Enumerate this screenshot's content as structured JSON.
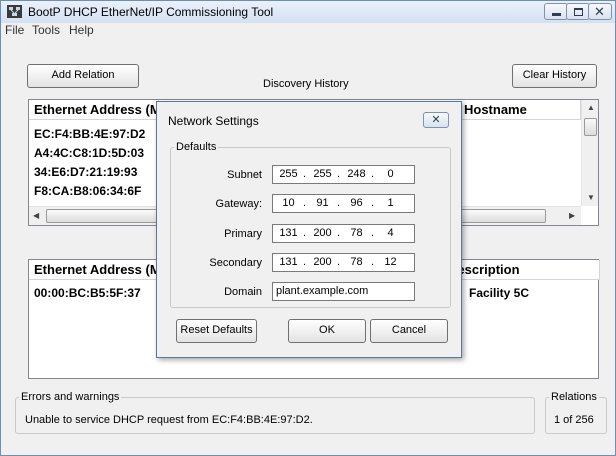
{
  "window": {
    "title": "BootP DHCP EtherNet/IP Commissioning Tool"
  },
  "menu": [
    "File",
    "Tools",
    "Help"
  ],
  "discovery": {
    "add_relation_label": "Add Relation",
    "title": "Discovery History",
    "clear_history_label": "Clear History",
    "columns": [
      "Ethernet Address (MAC)",
      "Hostname"
    ],
    "rows": [
      "EC:F4:BB:4E:97:D2",
      "A4:4C:C8:1D:5D:03",
      "34:E6:D7:21:19:93",
      "F8:CA:B8:06:34:6F"
    ]
  },
  "relations_list": {
    "columns": [
      "Ethernet Address (MAC)",
      "Description"
    ],
    "rows": [
      {
        "mac": "00:00:BC:B5:5F:37",
        "description": "Facility 5C"
      }
    ]
  },
  "errors": {
    "legend": "Errors and warnings",
    "message": "Unable to service DHCP request from EC:F4:BB:4E:97:D2."
  },
  "relations": {
    "legend": "Relations",
    "count": "1 of 256"
  },
  "dialog": {
    "title": "Network Settings",
    "close_glyph": "✕",
    "group_label": "Defaults",
    "fields": {
      "subnet": {
        "label": "Subnet",
        "octets": [
          "255",
          "255",
          "248",
          "0"
        ]
      },
      "gateway": {
        "label": "Gateway:",
        "octets": [
          "10",
          "91",
          "96",
          "1"
        ]
      },
      "primary": {
        "label": "Primary",
        "octets": [
          "131",
          "200",
          "78",
          "4"
        ]
      },
      "secondary": {
        "label": "Secondary",
        "octets": [
          "131",
          "200",
          "78",
          "12"
        ]
      },
      "domain": {
        "label": "Domain",
        "value": "plant.example.com"
      }
    },
    "reset_label": "Reset Defaults",
    "ok_label": "OK",
    "cancel_label": "Cancel"
  }
}
